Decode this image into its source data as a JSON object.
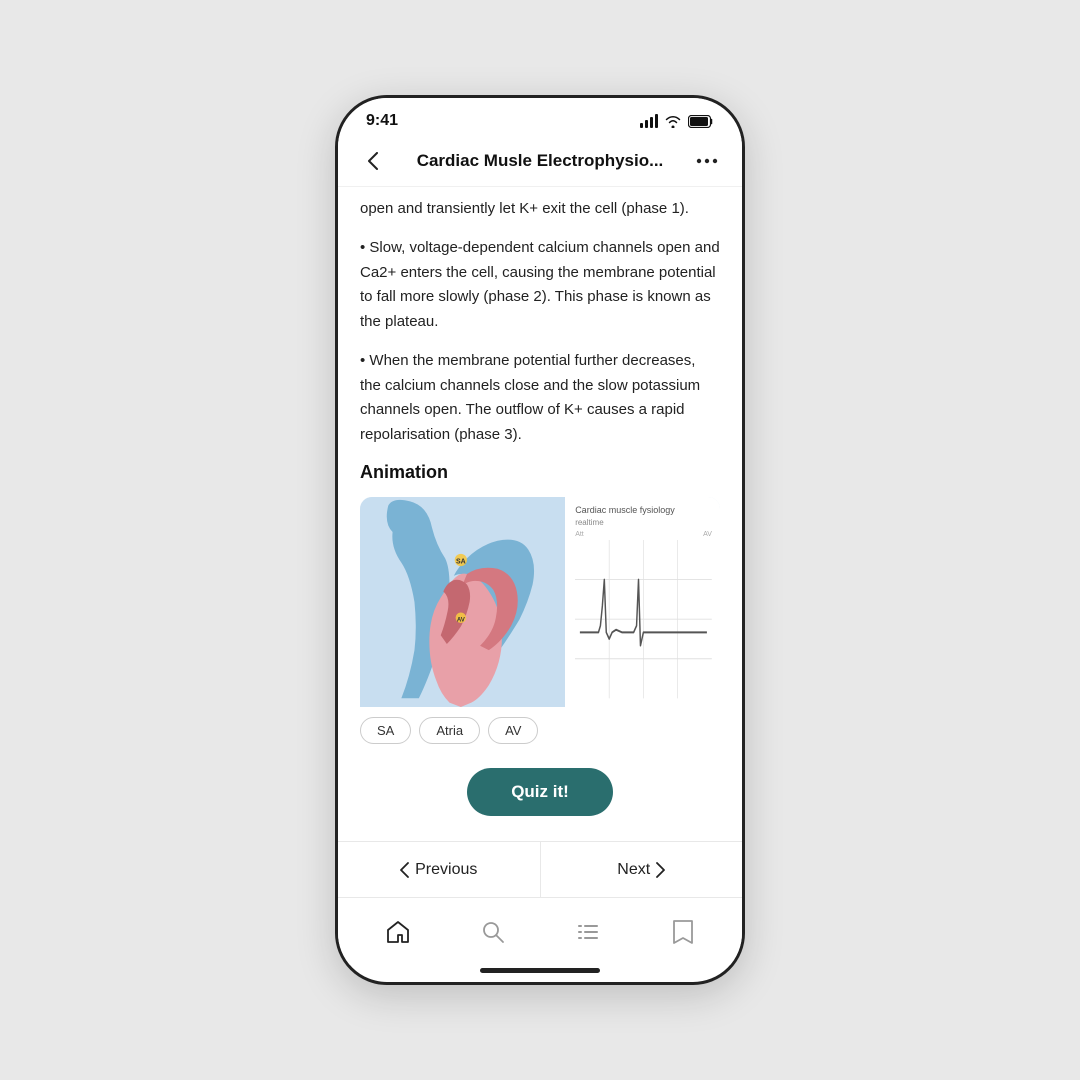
{
  "status_bar": {
    "time": "9:41"
  },
  "nav": {
    "title": "Cardiac Musle Electrophysio...",
    "back_label": "back",
    "more_label": "more"
  },
  "content": {
    "paragraph1": "open and transiently let K+ exit the cell (phase 1).",
    "paragraph2": "• Slow, voltage-dependent calcium channels open and Ca2+ enters the cell, causing the membrane potential to fall more slowly (phase 2). This phase is known as the plateau.",
    "paragraph3": "• When the membrane potential further decreases, the calcium channels close and the slow potassium channels open. The outflow of K+ causes a rapid repolarisation (phase 3).",
    "animation_title": "Animation",
    "animation_label": "Cardiac muscle fysiology",
    "animation_sublabel": "realtime",
    "tabs": [
      "SA",
      "Atria",
      "AV"
    ]
  },
  "quiz_button": {
    "label": "Quiz it!"
  },
  "pagination": {
    "previous_label": "Previous",
    "next_label": "Next"
  },
  "bottom_nav": {
    "home_label": "home",
    "search_label": "search",
    "list_label": "list",
    "bookmark_label": "bookmark"
  }
}
